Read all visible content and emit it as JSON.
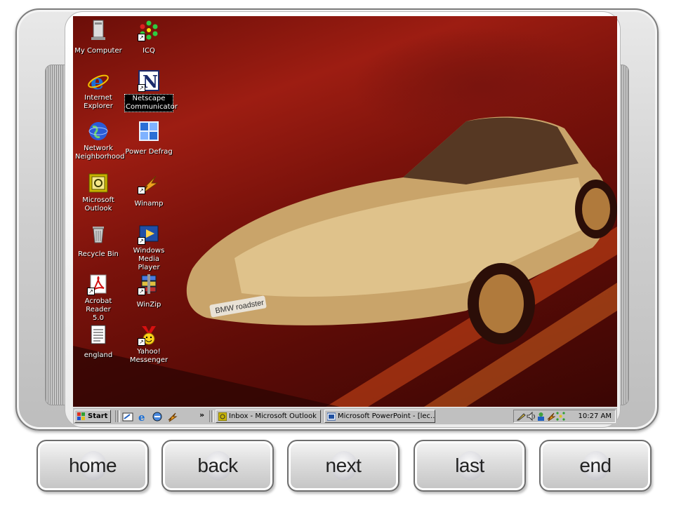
{
  "desktop": {
    "icons": [
      {
        "label": "My Computer",
        "icon": "computer-icon",
        "shortcut": false
      },
      {
        "label": "ICQ",
        "icon": "icq-flower-icon",
        "shortcut": true
      },
      {
        "label": "Internet Explorer",
        "icon": "internet-explorer-icon",
        "shortcut": false
      },
      {
        "label": "Netscape Communicator",
        "icon": "netscape-icon",
        "shortcut": true,
        "selected": true
      },
      {
        "label": "Network Neighborhood",
        "icon": "network-globe-icon",
        "shortcut": false
      },
      {
        "label": "Power Defrag",
        "icon": "defrag-icon",
        "shortcut": false
      },
      {
        "label": "Microsoft Outlook",
        "icon": "outlook-icon",
        "shortcut": false
      },
      {
        "label": "Winamp",
        "icon": "winamp-icon",
        "shortcut": true
      },
      {
        "label": "Recycle Bin",
        "icon": "recycle-bin-icon",
        "shortcut": false
      },
      {
        "label": "Windows Media Player",
        "icon": "media-player-icon",
        "shortcut": true
      },
      {
        "label": "Acrobat Reader 5.0",
        "icon": "acrobat-icon",
        "shortcut": true
      },
      {
        "label": "WinZip",
        "icon": "winzip-icon",
        "shortcut": true
      },
      {
        "label": "england",
        "icon": "document-icon",
        "shortcut": false
      },
      {
        "label": "Yahoo! Messenger",
        "icon": "yahoo-messenger-icon",
        "shortcut": true
      }
    ],
    "wallpaper_plate": "BMW roadster"
  },
  "taskbar": {
    "start_label": "Start",
    "quick_launch": [
      "show-desktop-icon",
      "internet-explorer-icon",
      "channels-icon",
      "winamp-icon"
    ],
    "chevron": "»",
    "tasks": [
      {
        "label": "Inbox - Microsoft Outlook",
        "icon": "outlook-icon",
        "pressed": false
      },
      {
        "label": "Microsoft PowerPoint - [lec...",
        "icon": "powerpoint-icon",
        "pressed": false
      }
    ],
    "tray_icons": [
      "pen-icon",
      "volume-icon",
      "user-icon",
      "winamp-tray-icon",
      "network-tray-icon"
    ],
    "clock": "10:27 AM"
  },
  "nav_buttons": [
    "home",
    "back",
    "next",
    "last",
    "end"
  ],
  "colors": {
    "taskbar": "#c0c0c0",
    "wallpaper_dark": "#5a0b06",
    "wallpaper_mid": "#9d1d12"
  }
}
